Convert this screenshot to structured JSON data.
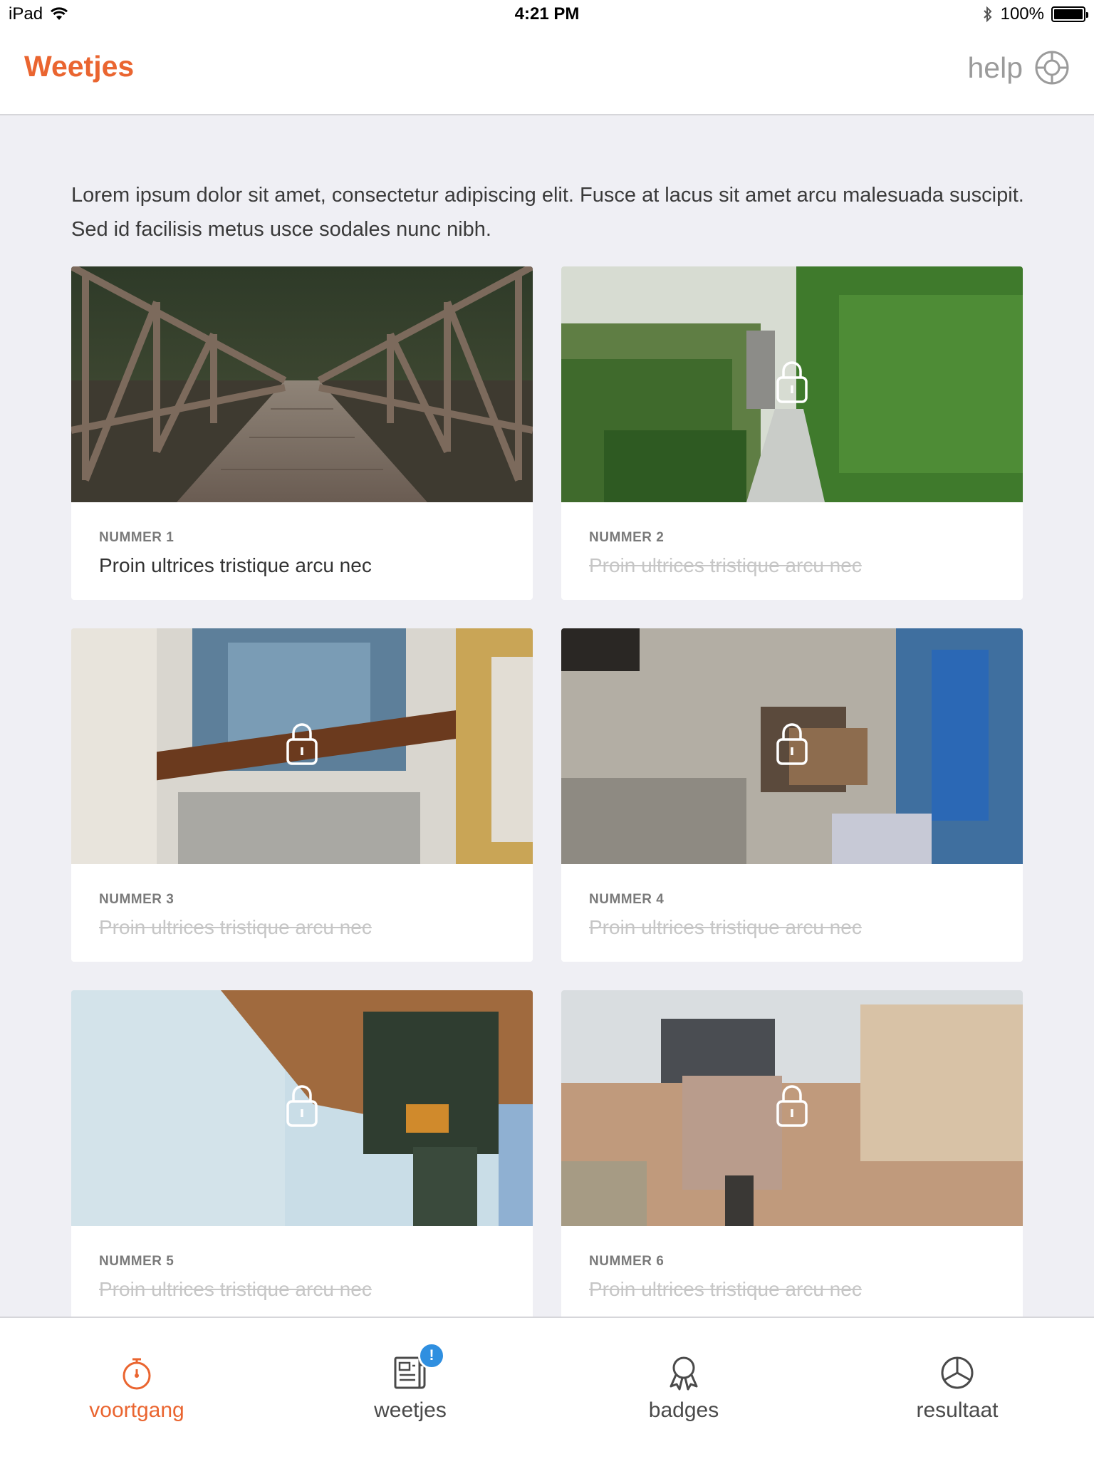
{
  "status_bar": {
    "device": "iPad",
    "time": "4:21 PM",
    "battery": "100%"
  },
  "header": {
    "title": "Weetjes",
    "help_label": "help"
  },
  "intro_text": "Lorem ipsum dolor sit amet, consectetur adipiscing elit. Fusce at lacus sit amet arcu malesuada suscipit. Sed id facilisis metus usce sodales nunc nibh.",
  "cards": [
    {
      "number": "NUMMER 1",
      "title": "Proin ultrices tristique arcu nec",
      "locked": false
    },
    {
      "number": "NUMMER 2",
      "title": "Proin ultrices tristique arcu nec",
      "locked": true
    },
    {
      "number": "NUMMER 3",
      "title": "Proin ultrices tristique arcu nec",
      "locked": true
    },
    {
      "number": "NUMMER 4",
      "title": "Proin ultrices tristique arcu nec",
      "locked": true
    },
    {
      "number": "NUMMER 5",
      "title": "Proin ultrices tristique arcu nec",
      "locked": true
    },
    {
      "number": "NUMMER 6",
      "title": "Proin ultrices tristique arcu nec",
      "locked": true
    }
  ],
  "tabs": [
    {
      "label": "voortgang",
      "icon": "stopwatch-icon",
      "active": true
    },
    {
      "label": "weetjes",
      "icon": "newspaper-icon",
      "active": false,
      "badge": "!"
    },
    {
      "label": "badges",
      "icon": "award-ribbon-icon",
      "active": false
    },
    {
      "label": "resultaat",
      "icon": "pie-chart-icon",
      "active": false
    }
  ],
  "colors": {
    "accent": "#ea6530",
    "badge": "#2f8fe0",
    "background": "#efeff4",
    "locked_text": "#c6c6c6"
  }
}
